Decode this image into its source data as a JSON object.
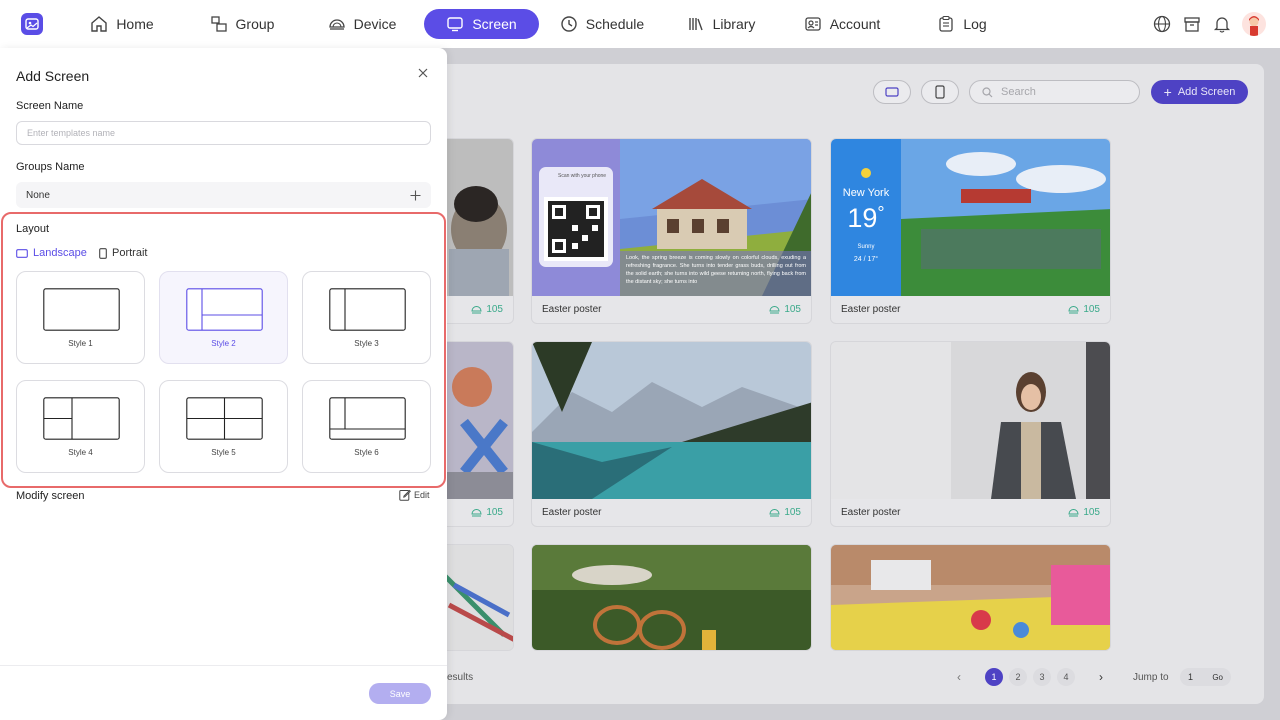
{
  "nav": {
    "items": [
      {
        "label": "Home",
        "icon": "home-icon"
      },
      {
        "label": "Group",
        "icon": "group-icon"
      },
      {
        "label": "Device",
        "icon": "device-icon"
      },
      {
        "label": "Screen",
        "icon": "screen-icon",
        "active": true
      },
      {
        "label": "Schedule",
        "icon": "clock-icon"
      },
      {
        "label": "Library",
        "icon": "library-icon"
      },
      {
        "label": "Account",
        "icon": "account-icon"
      },
      {
        "label": "Log",
        "icon": "log-icon"
      }
    ],
    "accent": "#5b4de6"
  },
  "toolbar": {
    "search_placeholder": "Search",
    "add_label": "Add Screen"
  },
  "cards": [
    {
      "title": "",
      "count": "105"
    },
    {
      "title": "Easter poster",
      "count": "105",
      "qr_caption": "Scan with your phone",
      "quote": "Look, the spring breeze is coming slowly on colorful clouds, exuding a refreshing fragrance. She turns into tender grass buds, drilling out from the solid earth; she turns into wild geese returning north, flying back from the distant sky; she turns into"
    },
    {
      "title": "Easter poster",
      "count": "105",
      "weather_city": "New York",
      "weather_temp": "19",
      "weather_unit": "°",
      "weather_cond": "Sunny",
      "weather_range": "24 / 17°"
    },
    {
      "title": "",
      "count": "105"
    },
    {
      "title": "Easter poster",
      "count": "105"
    },
    {
      "title": "Easter poster",
      "count": "105"
    }
  ],
  "pagination": {
    "results_text": "esults",
    "pages": [
      "1",
      "2",
      "3",
      "4"
    ],
    "jump_label": "Jump to",
    "jump_value": "1",
    "go_label": "Go"
  },
  "drawer": {
    "title": "Add Screen",
    "screen_name_label": "Screen Name",
    "screen_name_placeholder": "Enter templates name",
    "groups_label": "Groups Name",
    "groups_value": "None",
    "layout_label": "Layout",
    "landscape_label": "Landscape",
    "portrait_label": "Portrait",
    "styles": [
      "Style 1",
      "Style 2",
      "Style 3",
      "Style 4",
      "Style 5",
      "Style 6"
    ],
    "selected_style": "Style 2",
    "modify_label": "Modify screen",
    "edit_label": "Edit",
    "save_label": "Save"
  }
}
